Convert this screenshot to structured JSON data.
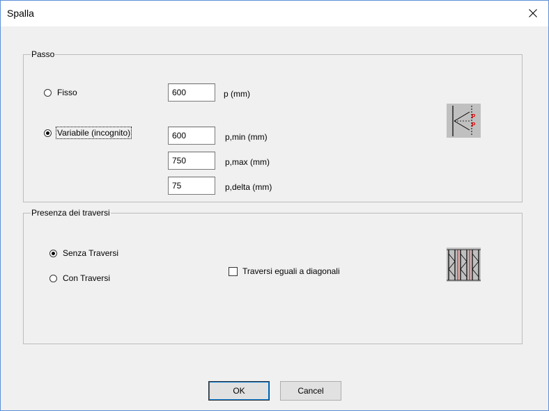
{
  "window": {
    "title": "Spalla"
  },
  "passo": {
    "label": "Passo",
    "fisso": {
      "label": "Fisso",
      "checked": false,
      "value": "600",
      "unit": "p (mm)"
    },
    "variabile": {
      "label": "Variabile (incognito)",
      "checked": true,
      "min": {
        "value": "600",
        "unit": "p,min (mm)"
      },
      "max": {
        "value": "750",
        "unit": "p,max (mm)"
      },
      "delta": {
        "value": "75",
        "unit": "p,delta (mm)"
      }
    },
    "diagram_icon": "truss-pitch-diagram-icon",
    "diagram_marks": [
      "P",
      "P"
    ]
  },
  "traversi": {
    "label": "Presenza dei traversi",
    "senza": {
      "label": "Senza Traversi",
      "checked": true
    },
    "con": {
      "label": "Con Traversi",
      "checked": false
    },
    "eguali": {
      "label": "Traversi eguali a diagonali",
      "checked": false
    },
    "diagram_icon": "rack-frame-icon"
  },
  "buttons": {
    "ok": "OK",
    "cancel": "Cancel"
  },
  "colors": {
    "accent": "#0078d7",
    "mark_red": "#e00000"
  }
}
